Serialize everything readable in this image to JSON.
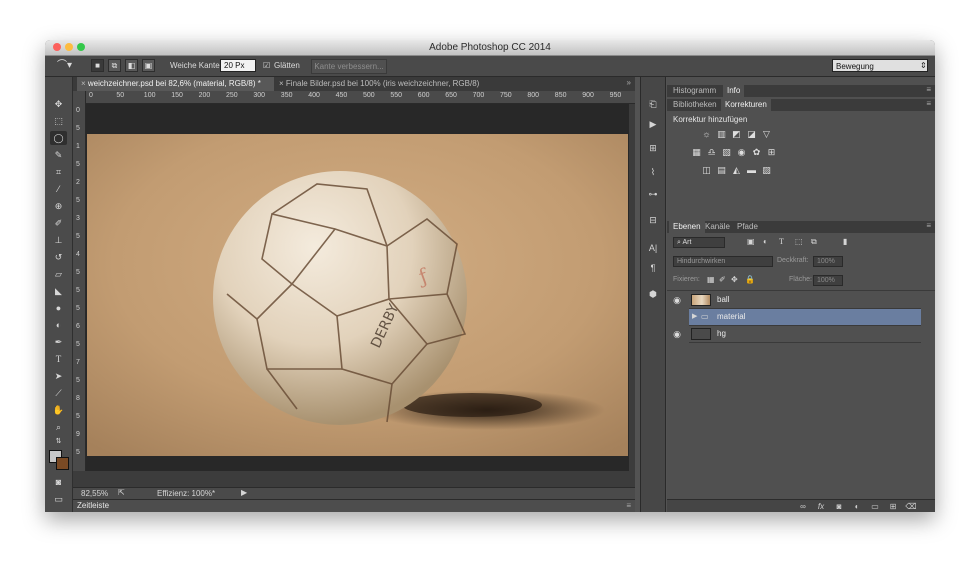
{
  "window": {
    "title": "Adobe Photoshop CC 2014"
  },
  "options_bar": {
    "feather_label": "Weiche Kante:",
    "feather_value": "20 Px",
    "antialias_label": "Glätten",
    "refine_edge_label": "Kante verbessern...",
    "workspace": "Bewegung"
  },
  "tabs": [
    {
      "label": "weichzeichner.psd bei 82,6% (material, RGB/8) *"
    },
    {
      "label": "Finale Bilder.psd bei 100% (iris weichzeichner, RGB/8)"
    }
  ],
  "ruler_top": [
    "0",
    "50",
    "100",
    "150",
    "200",
    "250",
    "300",
    "350",
    "400",
    "450",
    "500",
    "550",
    "600",
    "650",
    "700",
    "750",
    "800",
    "850",
    "900",
    "950"
  ],
  "ruler_left": [
    "0",
    "5",
    "1",
    "5",
    "2",
    "5",
    "3",
    "5",
    "4",
    "5",
    "5",
    "5",
    "6",
    "5",
    "7",
    "5",
    "8",
    "5",
    "9",
    "5"
  ],
  "status": {
    "zoom": "82,55%",
    "efficiency": "Effizienz: 100%*"
  },
  "timeline": {
    "label": "Zeitleiste"
  },
  "panels": {
    "top_tabs": [
      "Histogramm",
      "Info"
    ],
    "mid_tabs": [
      "Bibliotheken",
      "Korrekturen"
    ],
    "adjust_title": "Korrektur hinzufügen",
    "layer_tabs": [
      "Ebenen",
      "Kanäle",
      "Pfade"
    ],
    "filter_kind": "Art",
    "blend_mode": "Hindurchwirken",
    "opacity_label": "Deckkraft:",
    "opacity_value": "100%",
    "lock_label": "Fixieren:",
    "fill_label": "Fläche:",
    "fill_value": "100%",
    "layers": [
      {
        "name": "ball",
        "visible": true,
        "selected": false,
        "type": "smart"
      },
      {
        "name": "material",
        "visible": false,
        "selected": true,
        "type": "group"
      },
      {
        "name": "hg",
        "visible": true,
        "selected": false,
        "type": "normal"
      }
    ]
  },
  "colors": {
    "selected_layer": "#6a7ea0",
    "panel_bg": "#505050",
    "ui_dark": "#3c3c3c"
  }
}
